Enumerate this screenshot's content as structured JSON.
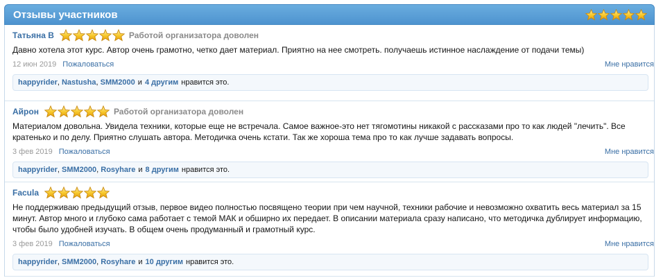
{
  "header": {
    "title": "Отзывы участников",
    "rating": 5
  },
  "reviews": [
    {
      "author": "Татьяна В",
      "stars": 5,
      "status": "Работой организатора доволен",
      "text": "Давно хотела этот курс. Автор очень грамотно, четко дает материал. Приятно на нее смотреть. получаешь истинное наслаждение от подачи темы)",
      "date": "12 июн 2019",
      "report": "Пожаловаться",
      "like": "Мне нравится",
      "likes": {
        "names": [
          "happyrider",
          "Nastusha",
          "SMM2000"
        ],
        "and": "и",
        "others": "4 другим",
        "tail": "нравится это."
      }
    },
    {
      "author": "Айрон",
      "stars": 5,
      "status": "Работой организатора доволен",
      "text": "Материалом довольна. Увидела техники, которые еще не встречала. Самое важное-это нет тягомотины никакой с рассказами про то как людей \"лечить\". Все кратенько и по делу. Приятно слушать автора. Методичка очень кстати. Так же хороша тема про то как лучше задавать вопросы.",
      "date": "3 фев 2019",
      "report": "Пожаловаться",
      "like": "Мне нравится",
      "likes": {
        "names": [
          "happyrider",
          "SMM2000",
          "Rosyhare"
        ],
        "and": "и",
        "others": "8 другим",
        "tail": "нравится это."
      }
    },
    {
      "author": "Facula",
      "stars": 5,
      "status": "",
      "text": "Не поддерживаю предыдущий отзыв, первое видео полностью посвящено теории при чем научной, техники рабочие и невозможно охватить весь материал за 15 минут. Автор много и глубоко сама работает с темой МАК и обширно их передает. В описании материала сразу написано, что методичка дублирует информацию, чтобы было удобней изучать. В общем очень продуманный и грамотный курс.",
      "date": "3 фев 2019",
      "report": "Пожаловаться",
      "like": "Мне нравится",
      "likes": {
        "names": [
          "happyrider",
          "SMM2000",
          "Rosyhare"
        ],
        "and": "и",
        "others": "10 другим",
        "tail": "нравится это."
      }
    }
  ]
}
